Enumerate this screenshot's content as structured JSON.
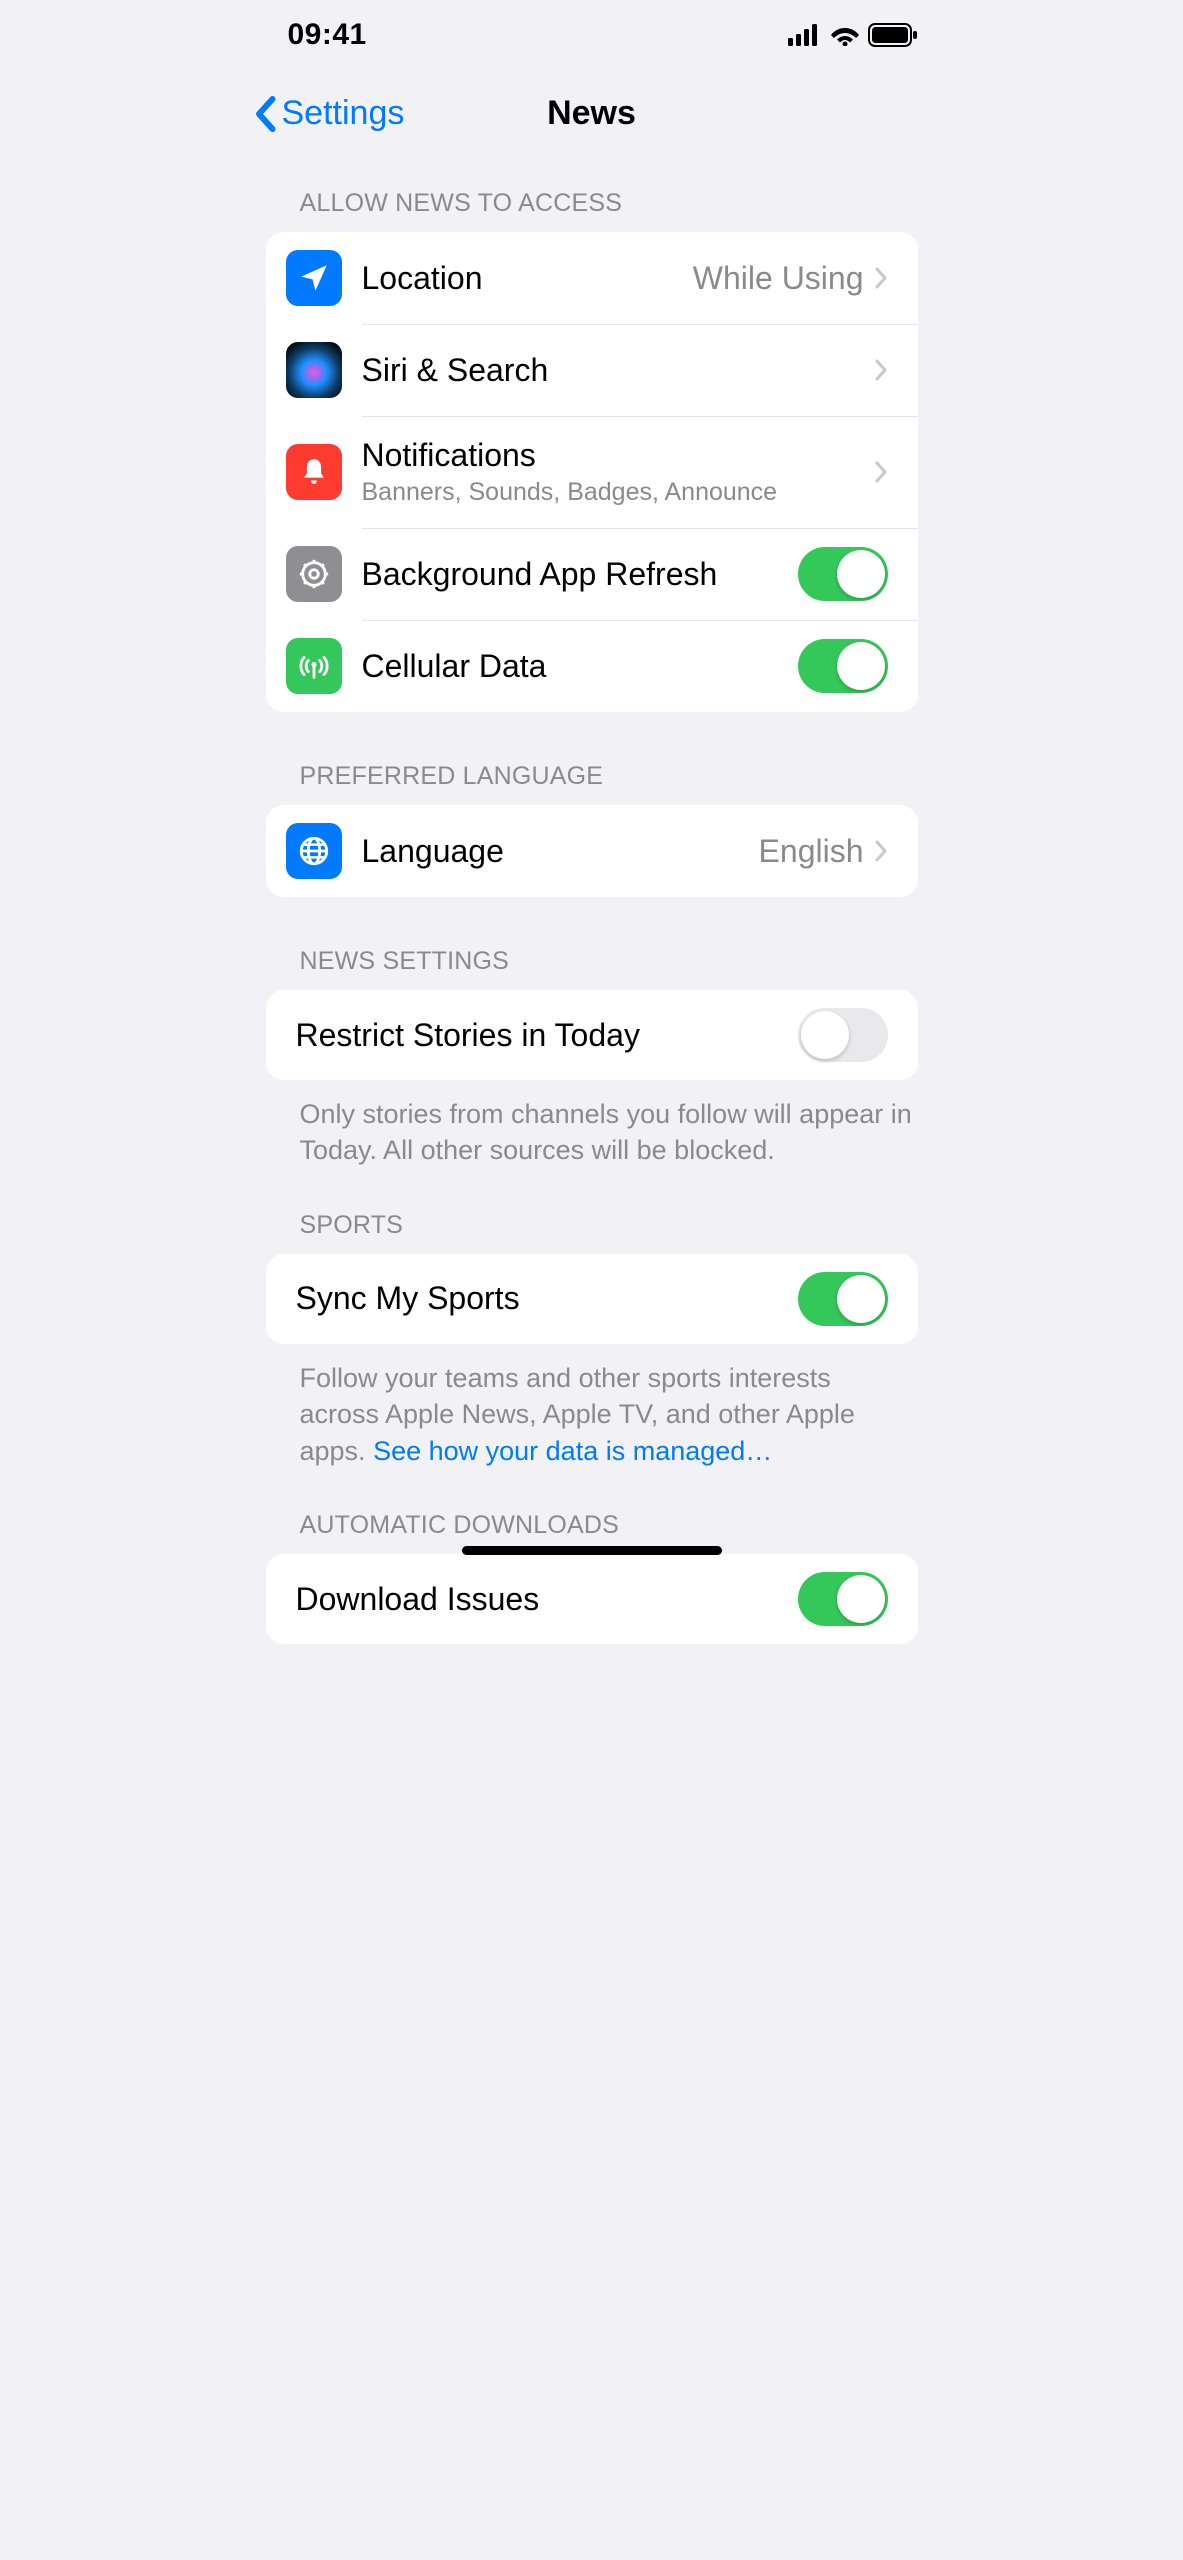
{
  "status": {
    "time": "09:41"
  },
  "nav": {
    "back_label": "Settings",
    "title": "News"
  },
  "sections": {
    "allow_access": {
      "header": "ALLOW NEWS TO ACCESS",
      "location": {
        "label": "Location",
        "value": "While Using"
      },
      "siri": {
        "label": "Siri & Search"
      },
      "notifications": {
        "label": "Notifications",
        "detail": "Banners, Sounds, Badges, Announce"
      },
      "bg_refresh": {
        "label": "Background App Refresh",
        "on": true
      },
      "cellular": {
        "label": "Cellular Data",
        "on": true
      }
    },
    "language": {
      "header": "PREFERRED LANGUAGE",
      "label": "Language",
      "value": "English"
    },
    "news_settings": {
      "header": "NEWS SETTINGS",
      "restrict": {
        "label": "Restrict Stories in Today",
        "on": false
      },
      "footer": "Only stories from channels you follow will appear in Today. All other sources will be blocked."
    },
    "sports": {
      "header": "SPORTS",
      "sync": {
        "label": "Sync My Sports",
        "on": true
      },
      "footer_text": "Follow your teams and other sports interests across Apple News, Apple TV, and other Apple apps. ",
      "footer_link": "See how your data is managed…"
    },
    "auto_downloads": {
      "header": "AUTOMATIC DOWNLOADS",
      "download": {
        "label": "Download Issues",
        "on": true
      }
    }
  }
}
